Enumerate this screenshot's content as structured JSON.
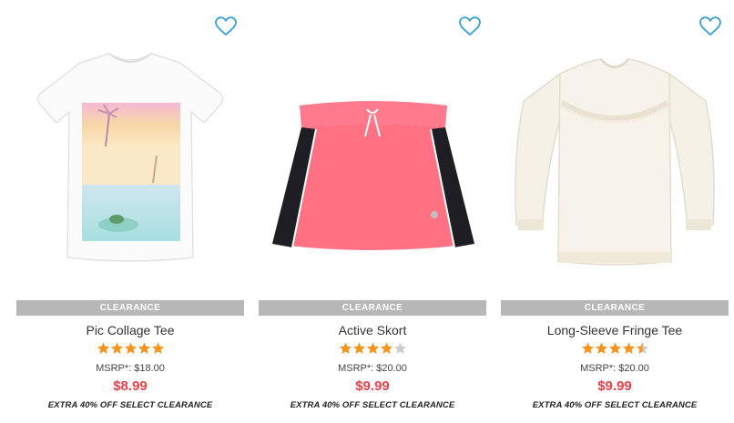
{
  "products": [
    {
      "name": "Pic Collage Tee",
      "badge": "CLEARANCE",
      "msrp": "MSRP*: $18.00",
      "price": "$8.99",
      "promo": "EXTRA 40% OFF SELECT CLEARANCE",
      "rating": 5,
      "image": "white-tee-with-photo-collage"
    },
    {
      "name": "Active Skort",
      "badge": "CLEARANCE",
      "msrp": "MSRP*: $20.00",
      "price": "$9.99",
      "promo": "EXTRA 40% OFF SELECT CLEARANCE",
      "rating": 4,
      "image": "pink-skort-with-black-side-panels"
    },
    {
      "name": "Long-Sleeve Fringe Tee",
      "badge": "CLEARANCE",
      "msrp": "MSRP*: $20.00",
      "price": "$9.99",
      "promo": "EXTRA 40% OFF SELECT CLEARANCE",
      "rating": 4.5,
      "image": "cream-long-sleeve-fringe-top"
    }
  ],
  "colors": {
    "heart": "#3aa0cf",
    "badge_bg": "#b7b7b7",
    "price": "#e8414a",
    "star": "#f7941d",
    "star_empty": "#cccccc"
  },
  "icons": {
    "favorite": "heart-outline-icon",
    "rating": "star-icon"
  }
}
